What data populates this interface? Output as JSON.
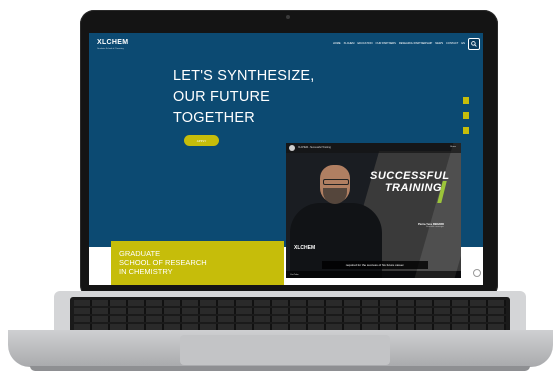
{
  "site": {
    "logo_text": "XLCHEM",
    "logo_subtitle": "Graduate School of Chemistry"
  },
  "nav": {
    "items": [
      "HOME",
      "XLCHEM",
      "EDUCATION",
      "OUR PARTNERS",
      "RESEARCH PARTNERSHIP",
      "NEWS",
      "CONTACT"
    ],
    "lang": "EN"
  },
  "hero": {
    "headline_lines": [
      "LET'S SYNTHESIZE,",
      "OUR FUTURE",
      "TOGETHER"
    ],
    "apply_label": "APPLY"
  },
  "graduate": {
    "lines": [
      "GRADUATE",
      "SCHOOL OF RESEARCH",
      "IN CHEMISTRY"
    ]
  },
  "video": {
    "title": "XLCHEM - Successful Training",
    "share": "Share",
    "overlay_lines": [
      "SUCCESSFUL",
      "TRAINING"
    ],
    "logo": "XLCHEM",
    "person_name": "Pierre-Yves RENARD",
    "person_role": "Scientific manager",
    "caption": "required for the success of his future career.",
    "platform": "YouTube"
  },
  "colors": {
    "hero_blue": "#0c4a72",
    "accent_yellow": "#c6bd0a",
    "training_green": "#9cc53a"
  }
}
